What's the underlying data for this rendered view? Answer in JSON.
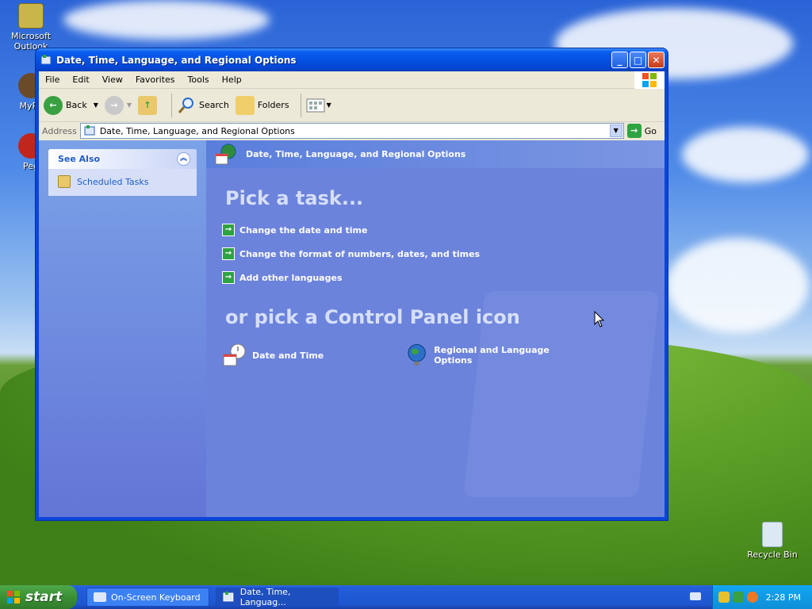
{
  "desktop": {
    "icons": [
      {
        "label": "Microsoft Outlook"
      },
      {
        "label": "MyPa"
      },
      {
        "label": "Peg"
      },
      {
        "label": "Recycle Bin"
      }
    ]
  },
  "window": {
    "title": "Date, Time, Language, and Regional Options",
    "menu": [
      "File",
      "Edit",
      "View",
      "Favorites",
      "Tools",
      "Help"
    ],
    "toolbar": {
      "back_label": "Back",
      "search_label": "Search",
      "folders_label": "Folders"
    },
    "address": {
      "label": "Address",
      "value": "Date, Time, Language, and Regional Options",
      "go_label": "Go"
    },
    "left_pane": {
      "see_also_title": "See Also",
      "see_also_items": [
        "Scheduled Tasks"
      ]
    },
    "main": {
      "banner_title": "Date, Time, Language, and Regional Options",
      "pick_task_heading": "Pick a task...",
      "tasks": [
        "Change the date and time",
        "Change the format of numbers, dates, and times",
        "Add other languages"
      ],
      "pick_icon_heading": "or pick a Control Panel icon",
      "cp_icons": [
        "Date and Time",
        "Regional and Language Options"
      ]
    }
  },
  "taskbar": {
    "start_label": "start",
    "tasks": [
      "On-Screen Keyboard",
      "Date, Time, Languag..."
    ],
    "clock": "2:28 PM"
  },
  "colors": {
    "title_bar": "#0551e3",
    "task_pane": "#6c83dc",
    "link_text": "#215dc6",
    "start_green": "#3b8f36"
  }
}
